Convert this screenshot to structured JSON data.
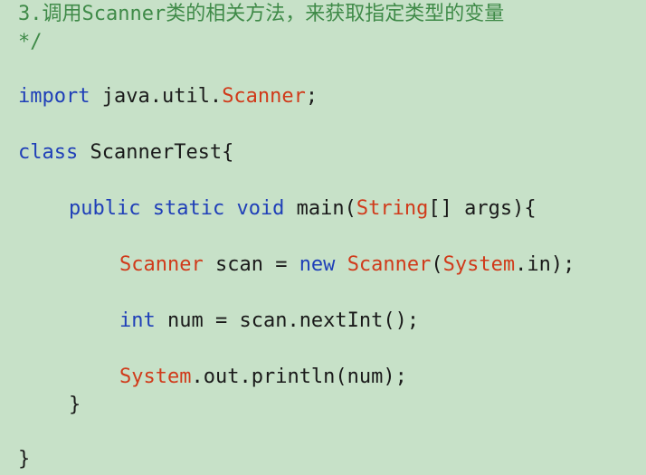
{
  "comment": {
    "line1": "3.调用Scanner类的相关方法，来获取指定类型的变量",
    "line2": "*/"
  },
  "code": {
    "import_kw": "import",
    "import_pkg": " java.util.",
    "import_cls": "Scanner",
    "import_end": ";",
    "class_kw": "class",
    "class_name": " ScannerTest{",
    "main_public": "public",
    "main_static": " static",
    "main_void": " void",
    "main_name": " main(",
    "main_string": "String",
    "main_rest": "[] args){",
    "scan_type": "Scanner",
    "scan_var": " scan = ",
    "scan_new": "new",
    "scan_space": " ",
    "scan_ctor": "Scanner",
    "scan_paren": "(",
    "scan_system": "System",
    "scan_end": ".in);",
    "int_kw": "int",
    "int_rest": " num = scan.nextInt();",
    "print_system": "System",
    "print_rest": ".out.println(num);",
    "main_close": "}",
    "class_close": "}"
  },
  "colors": {
    "background": "#c7e1c8",
    "keyword": "#1f3fb8",
    "class_name": "#d03a1a",
    "comment": "#3f8a48"
  }
}
